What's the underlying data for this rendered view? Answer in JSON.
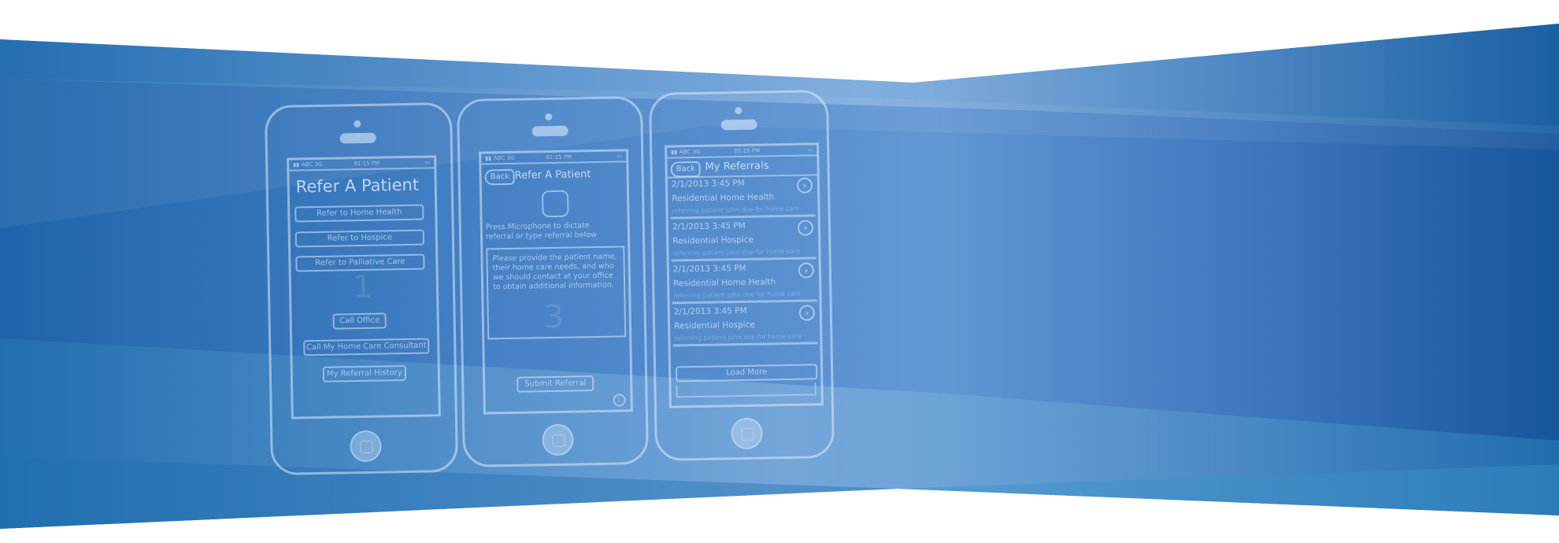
{
  "colors": {
    "band_dark": "#1a5aa0",
    "band_mid": "#5b8fd0",
    "band_light": "#9cc2e8",
    "sketch_line": "#dcebff",
    "page_bg": "#ffffff"
  },
  "status_bar": {
    "carrier": "ABC 3G",
    "time": "01:15 PM",
    "signal_icon": "signal-bars-icon",
    "battery_icon": "battery-icon"
  },
  "phone1": {
    "title": "Refer A Patient",
    "buttons": [
      "Refer to Home Health",
      "Refer to Hospice",
      "Refer to Palliative Care",
      "Call  Office",
      "Call My Home Care Consultant",
      "My Referral History"
    ],
    "ghost_number": "1"
  },
  "phone2": {
    "back_label": "Back",
    "title": "Refer A Patient",
    "instruction": "Press Microphone to dictate referral or type referral below",
    "textarea_text": "Please provide the patient name, their home care needs, and who we should contact at your office to obtain additional information.",
    "ghost_number": "3",
    "submit_label": "Submit Referral",
    "mic_icon": "microphone-icon"
  },
  "phone3": {
    "back_label": "Back",
    "title": "My Referrals",
    "referrals": [
      {
        "date": "2/1/2013 3:45 PM",
        "type": "Residential Home Health",
        "note": "referring patient john doe for home care"
      },
      {
        "date": "2/1/2013 3:45 PM",
        "type": "Residential Hospice",
        "note": "referring patient john doe for home care"
      },
      {
        "date": "2/1/2013 3:45 PM",
        "type": "Residential Home Health",
        "note": "referring patient john doe for home care"
      },
      {
        "date": "2/1/2013 3:45 PM",
        "type": "Residential Hospice",
        "note": "referring patient john doe for home care"
      }
    ],
    "load_more_label": "Load More",
    "chevron_glyph": "›"
  }
}
